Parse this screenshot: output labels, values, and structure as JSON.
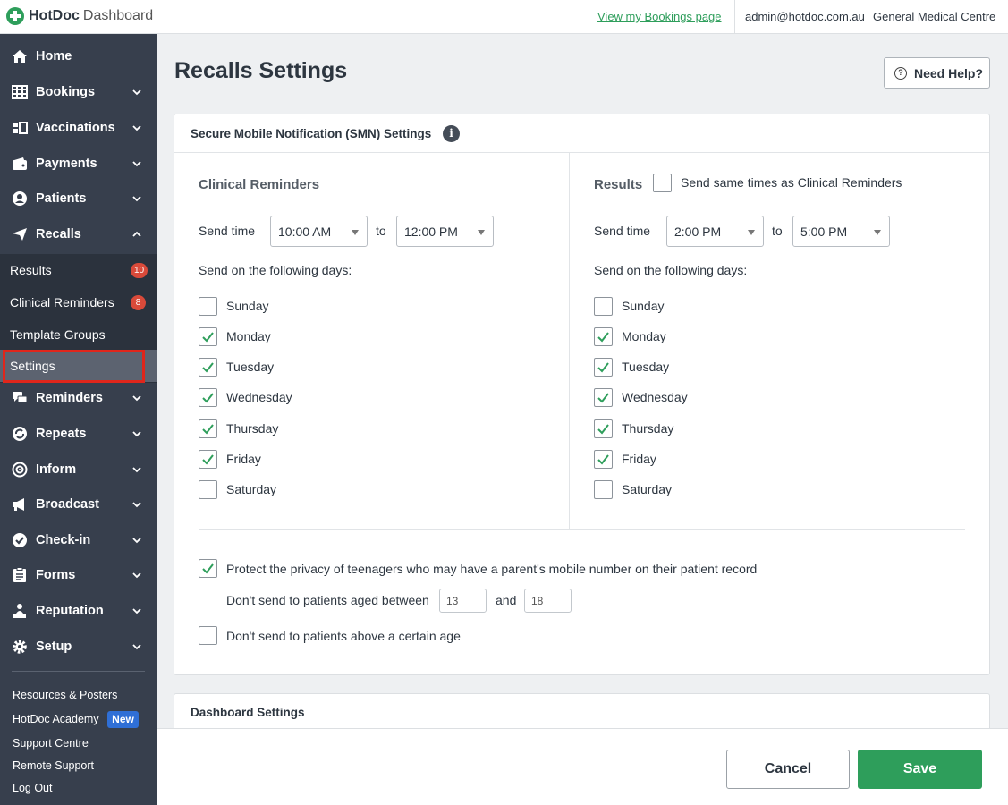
{
  "topbar": {
    "brand": "HotDoc",
    "brand_sub": "Dashboard",
    "bookings_link": "View my Bookings page",
    "email": "admin@hotdoc.com.au",
    "clinic": "General Medical Centre"
  },
  "sidebar": {
    "items": [
      {
        "label": "Home",
        "icon": "home-icon"
      },
      {
        "label": "Bookings",
        "icon": "calendar-grid-icon"
      },
      {
        "label": "Vaccinations",
        "icon": "vaccine-icon"
      },
      {
        "label": "Payments",
        "icon": "wallet-icon"
      },
      {
        "label": "Patients",
        "icon": "user-circle-icon"
      },
      {
        "label": "Recalls",
        "icon": "paper-plane-icon"
      },
      {
        "label": "Reminders",
        "icon": "chat-bubbles-icon"
      },
      {
        "label": "Repeats",
        "icon": "refresh-icon"
      },
      {
        "label": "Inform",
        "icon": "target-icon"
      },
      {
        "label": "Broadcast",
        "icon": "megaphone-icon"
      },
      {
        "label": "Check-in",
        "icon": "check-circle-icon"
      },
      {
        "label": "Forms",
        "icon": "clipboard-icon"
      },
      {
        "label": "Reputation",
        "icon": "person-stand-icon"
      },
      {
        "label": "Setup",
        "icon": "gear-icon"
      }
    ],
    "recalls_sub": [
      {
        "label": "Results",
        "badge": "10"
      },
      {
        "label": "Clinical Reminders",
        "badge": "8"
      },
      {
        "label": "Template Groups"
      },
      {
        "label": "Settings"
      }
    ],
    "footer_links": [
      "Resources & Posters",
      "HotDoc Academy",
      "Support Centre",
      "Remote Support",
      "Log Out"
    ],
    "new_badge": "New"
  },
  "page": {
    "title": "Recalls Settings",
    "help_label": "Need Help?"
  },
  "smn": {
    "title": "Secure Mobile Notification (SMN) Settings",
    "clinical": {
      "title": "Clinical Reminders",
      "send_time_label": "Send time",
      "from": "10:00 AM",
      "to_label": "to",
      "to": "12:00 PM",
      "days_label": "Send on the following days:",
      "days": [
        {
          "label": "Sunday",
          "checked": false
        },
        {
          "label": "Monday",
          "checked": true
        },
        {
          "label": "Tuesday",
          "checked": true
        },
        {
          "label": "Wednesday",
          "checked": true
        },
        {
          "label": "Thursday",
          "checked": true
        },
        {
          "label": "Friday",
          "checked": true
        },
        {
          "label": "Saturday",
          "checked": false
        }
      ]
    },
    "results": {
      "title": "Results",
      "same_times_label": "Send same times as Clinical Reminders",
      "same_times_checked": false,
      "send_time_label": "Send time",
      "from": "2:00 PM",
      "to_label": "to",
      "to": "5:00 PM",
      "days_label": "Send on the following days:",
      "days": [
        {
          "label": "Sunday",
          "checked": false
        },
        {
          "label": "Monday",
          "checked": true
        },
        {
          "label": "Tuesday",
          "checked": true
        },
        {
          "label": "Wednesday",
          "checked": true
        },
        {
          "label": "Thursday",
          "checked": true
        },
        {
          "label": "Friday",
          "checked": true
        },
        {
          "label": "Saturday",
          "checked": false
        }
      ]
    },
    "privacy": {
      "teen_label": "Protect the privacy of teenagers who may have a parent's mobile number on their patient record",
      "teen_checked": true,
      "age_between_label": "Don't send to patients aged between",
      "age_min": "13",
      "and_label": "and",
      "age_max": "18",
      "above_age_label": "Don't send to patients above a certain age",
      "above_age_checked": false
    }
  },
  "dashboard_settings": {
    "title": "Dashboard Settings"
  },
  "footer": {
    "cancel_label": "Cancel",
    "save_label": "Save"
  },
  "colors": {
    "brand_green": "#2e9e5b",
    "sidebar_bg": "#373f4d",
    "badge_red": "#d94a3a",
    "highlight_red": "#e0261b",
    "new_blue": "#2f6fd6"
  }
}
